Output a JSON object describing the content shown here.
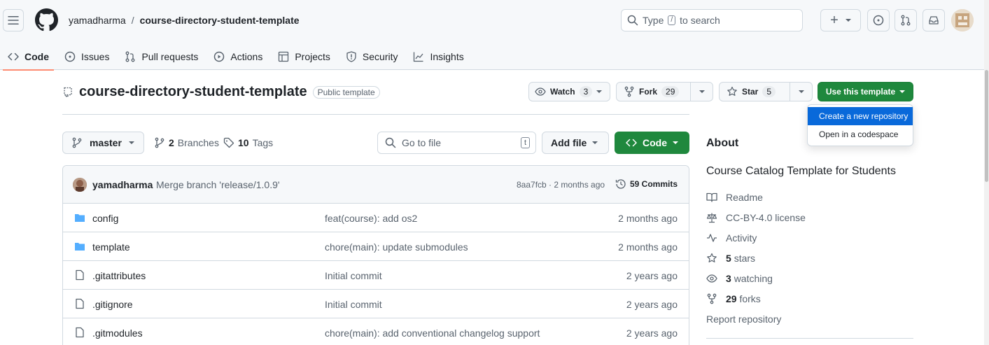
{
  "header": {
    "owner": "yamadharma",
    "separator": "/",
    "repo": "course-directory-student-template",
    "search_type": "Type",
    "search_key": "/",
    "search_rest": "to search",
    "plus_label": "+"
  },
  "tabs": [
    {
      "label": "Code",
      "icon": "code-icon"
    },
    {
      "label": "Issues",
      "icon": "issue-icon"
    },
    {
      "label": "Pull requests",
      "icon": "pull-request-icon"
    },
    {
      "label": "Actions",
      "icon": "play-icon"
    },
    {
      "label": "Projects",
      "icon": "table-icon"
    },
    {
      "label": "Security",
      "icon": "shield-icon"
    },
    {
      "label": "Insights",
      "icon": "graph-icon"
    }
  ],
  "repo_header": {
    "name": "course-directory-student-template",
    "badge": "Public template",
    "watch_label": "Watch",
    "watch_count": "3",
    "fork_label": "Fork",
    "fork_count": "29",
    "star_label": "Star",
    "star_count": "5",
    "use_template": "Use this template"
  },
  "template_menu": {
    "create": "Create a new repository",
    "codespace": "Open in a codespace"
  },
  "toolbar": {
    "branch": "master",
    "branches_count": "2",
    "branches_label": "Branches",
    "tags_count": "10",
    "tags_label": "Tags",
    "go_to_file": "Go to file",
    "go_to_file_key": "t",
    "add_file": "Add file",
    "code": "Code"
  },
  "latest_commit": {
    "author": "yamadharma",
    "message": "Merge branch 'release/1.0.9'",
    "hash_age": "8aa7fcb · 2 months ago",
    "commits": "59 Commits"
  },
  "files": [
    {
      "name": "config",
      "type": "folder",
      "message": "feat(course): add os2",
      "age": "2 months ago"
    },
    {
      "name": "template",
      "type": "folder",
      "message": "chore(main): update submodules",
      "age": "2 months ago"
    },
    {
      "name": ".gitattributes",
      "type": "file",
      "message": "Initial commit",
      "age": "2 years ago"
    },
    {
      "name": ".gitignore",
      "type": "file",
      "message": "Initial commit",
      "age": "2 years ago"
    },
    {
      "name": ".gitmodules",
      "type": "file",
      "message": "chore(main): add conventional changelog support",
      "age": "2 years ago"
    }
  ],
  "about": {
    "heading": "About",
    "description": "Course Catalog Template for Students",
    "readme": "Readme",
    "license": "CC-BY-4.0 license",
    "activity": "Activity",
    "stars_count": "5",
    "stars_label": "stars",
    "watching_count": "3",
    "watching_label": "watching",
    "forks_count": "29",
    "forks_label": "forks",
    "report": "Report repository"
  },
  "colors": {
    "primary_green": "#1f883d",
    "accent_blue": "#0969da",
    "tab_underline": "#fd8c73",
    "folder": "#54aeff"
  }
}
